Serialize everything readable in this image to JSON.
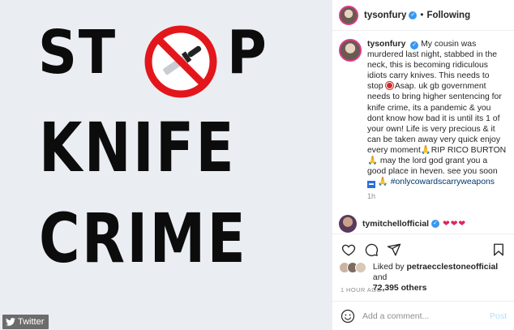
{
  "poster": {
    "line1_left": "ST",
    "line1_right": "P",
    "line2": "KNIFE",
    "line3": "CRIME"
  },
  "watermark": {
    "label": "Twitter"
  },
  "header": {
    "username": "tysonfury",
    "separator": "•",
    "follow_label": "Following"
  },
  "caption": {
    "username": "tysonfury",
    "text_part1": "My cousin was murdered last night, stabbed in the neck, this is becoming ridiculous idiots carry knives. This needs to stop",
    "text_part2": "Asap. uk gb government needs to bring higher sentencing for knife crime, its a pandemic & you dont know how bad it is until its 1 of your own! Life is very precious & it can be taken away very quick enjoy every moment",
    "text_part3": "RIP RICO BURTON",
    "text_part4": "may the lord god grant you a good place in heven. see you soon",
    "hashtag": "#onlycowardscarryweapons",
    "age": "1h"
  },
  "comment": {
    "username": "tymitchellofficial",
    "hearts": "❤❤❤"
  },
  "likes": {
    "prefix": "Liked by",
    "liker": "petraecclestoneofficial",
    "and": "and",
    "count": "72,395 others"
  },
  "timestamp": "1 HOUR AGO",
  "add_comment": {
    "placeholder": "Add a comment...",
    "post_label": "Post"
  },
  "colors": {
    "link": "#00376b",
    "verified": "#3897f0",
    "stop_red": "#e3161b",
    "post_disabled": "#b2dffc"
  },
  "icons": [
    "heart-icon",
    "comment-icon",
    "share-icon",
    "bookmark-icon",
    "smile-icon",
    "verified-icon",
    "twitter-bird-icon"
  ]
}
